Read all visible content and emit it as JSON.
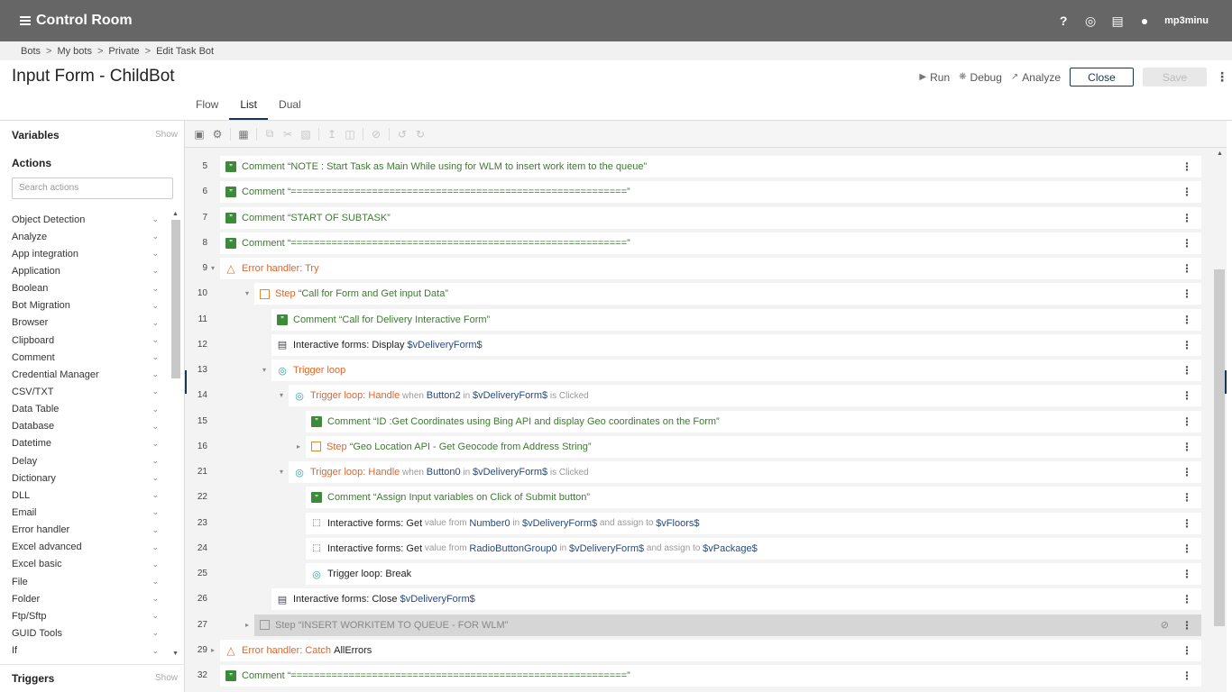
{
  "app": {
    "title": "Control Room",
    "user": "mp3minu"
  },
  "breadcrumb": [
    "Bots",
    "My bots",
    "Private",
    "Edit Task Bot"
  ],
  "page": {
    "title": "Input Form - ChildBot"
  },
  "header_actions": {
    "run": "Run",
    "debug": "Debug",
    "analyze": "Analyze",
    "close": "Close",
    "save": "Save"
  },
  "tabs": [
    {
      "label": "Flow"
    },
    {
      "label": "List",
      "active": true
    },
    {
      "label": "Dual"
    }
  ],
  "left": {
    "variables": "Variables",
    "actions": "Actions",
    "triggers": "Triggers",
    "show": "Show",
    "search_placeholder": "Search actions",
    "action_items": [
      "Object Detection",
      "Analyze",
      "App integration",
      "Application",
      "Boolean",
      "Bot Migration",
      "Browser",
      "Clipboard",
      "Comment",
      "Credential Manager",
      "CSV/TXT",
      "Data Table",
      "Database",
      "Datetime",
      "Delay",
      "Dictionary",
      "DLL",
      "Email",
      "Error handler",
      "Excel advanced",
      "Excel basic",
      "File",
      "Folder",
      "Ftp/Sftp",
      "GUID Tools",
      "If"
    ]
  },
  "lines": [
    {
      "n": "5",
      "indent": 0,
      "icon": "comment",
      "parts": [
        [
          "green",
          "Comment"
        ],
        [
          "green",
          " “NOTE : Start Task as Main While using for WLM to insert work item to the queue”"
        ]
      ]
    },
    {
      "n": "6",
      "indent": 0,
      "icon": "comment",
      "parts": [
        [
          "green",
          "Comment"
        ],
        [
          "green",
          " “==========================================================”"
        ]
      ]
    },
    {
      "n": "7",
      "indent": 0,
      "icon": "comment",
      "parts": [
        [
          "green",
          "Comment"
        ],
        [
          "green",
          " “START OF SUBTASK”"
        ]
      ]
    },
    {
      "n": "8",
      "indent": 0,
      "icon": "comment",
      "parts": [
        [
          "green",
          "Comment"
        ],
        [
          "green",
          " “==========================================================”"
        ]
      ]
    },
    {
      "n": "9",
      "indent": 0,
      "icon": "error",
      "fold": "open",
      "parts": [
        [
          "orange",
          "Error handler: Try"
        ]
      ]
    },
    {
      "n": "10",
      "indent": 1,
      "icon": "step",
      "fold": "open",
      "parts": [
        [
          "orange",
          "Step"
        ],
        [
          "green",
          " “Call for Form and Get input Data”"
        ]
      ]
    },
    {
      "n": "11",
      "indent": 2,
      "icon": "comment",
      "parts": [
        [
          "green",
          "Comment"
        ],
        [
          "green",
          " “Call for Delivery Interactive Form”"
        ]
      ]
    },
    {
      "n": "12",
      "indent": 2,
      "icon": "form",
      "parts": [
        [
          "dark",
          "Interactive forms: Display "
        ],
        [
          "blue",
          "$vDeliveryForm$"
        ]
      ]
    },
    {
      "n": "13",
      "indent": 2,
      "icon": "trigger",
      "fold": "open",
      "parts": [
        [
          "orange",
          "Trigger loop"
        ]
      ]
    },
    {
      "n": "14",
      "indent": 3,
      "icon": "trigger",
      "fold": "open",
      "parts": [
        [
          "orange",
          "Trigger loop: Handle"
        ],
        [
          "gray",
          " when "
        ],
        [
          "blue",
          "Button2"
        ],
        [
          "gray",
          " in "
        ],
        [
          "blue",
          "$vDeliveryForm$"
        ],
        [
          "gray",
          " is Clicked"
        ]
      ]
    },
    {
      "n": "15",
      "indent": 4,
      "icon": "comment",
      "parts": [
        [
          "green",
          "Comment"
        ],
        [
          "green",
          " “ID :Get Coordinates using Bing API and display Geo coordinates on the Form”"
        ]
      ]
    },
    {
      "n": "16",
      "indent": 4,
      "icon": "step",
      "fold": "closed",
      "parts": [
        [
          "orange",
          "Step"
        ],
        [
          "green",
          " “Geo Location API - Get Geocode from Address String”"
        ]
      ]
    },
    {
      "n": "21",
      "indent": 3,
      "icon": "trigger",
      "fold": "open",
      "parts": [
        [
          "orange",
          "Trigger loop: Handle"
        ],
        [
          "gray",
          " when "
        ],
        [
          "blue",
          "Button0"
        ],
        [
          "gray",
          " in "
        ],
        [
          "blue",
          "$vDeliveryForm$"
        ],
        [
          "gray",
          " is Clicked"
        ]
      ]
    },
    {
      "n": "22",
      "indent": 4,
      "icon": "comment",
      "parts": [
        [
          "green",
          "Comment"
        ],
        [
          "green",
          " “Assign Input variables on Click of Submit button”"
        ]
      ]
    },
    {
      "n": "23",
      "indent": 4,
      "icon": "get",
      "parts": [
        [
          "dark",
          "Interactive forms: Get"
        ],
        [
          "gray",
          " value from "
        ],
        [
          "blue",
          "Number0"
        ],
        [
          "gray",
          " in "
        ],
        [
          "blue",
          "$vDeliveryForm$"
        ],
        [
          "gray",
          " and assign to "
        ],
        [
          "blue",
          "$vFloors$"
        ]
      ]
    },
    {
      "n": "24",
      "indent": 4,
      "icon": "get",
      "parts": [
        [
          "dark",
          "Interactive forms: Get"
        ],
        [
          "gray",
          " value from "
        ],
        [
          "blue",
          "RadioButtonGroup0"
        ],
        [
          "gray",
          " in "
        ],
        [
          "blue",
          "$vDeliveryForm$"
        ],
        [
          "gray",
          " and assign to "
        ],
        [
          "blue",
          "$vPackage$"
        ]
      ]
    },
    {
      "n": "25",
      "indent": 4,
      "icon": "trigger",
      "parts": [
        [
          "dark",
          "Trigger loop: Break"
        ]
      ]
    },
    {
      "n": "26",
      "indent": 2,
      "icon": "form",
      "parts": [
        [
          "dark",
          "Interactive forms: Close "
        ],
        [
          "blue",
          "$vDeliveryForm$"
        ]
      ]
    },
    {
      "n": "27",
      "indent": 1,
      "icon": "step",
      "fold": "closed",
      "disabled": true,
      "parts": [
        [
          "gray2",
          "Step"
        ],
        [
          "gray2",
          " “INSERT WORKITEM TO QUEUE - FOR WLM”"
        ]
      ]
    },
    {
      "n": "29",
      "indent": 0,
      "icon": "error",
      "fold": "closed",
      "parts": [
        [
          "orange",
          "Error handler: Catch "
        ],
        [
          "dark",
          "AllErrors"
        ]
      ]
    },
    {
      "n": "32",
      "indent": 0,
      "icon": "comment",
      "parts": [
        [
          "green",
          "Comment"
        ],
        [
          "green",
          " “==========================================================”"
        ]
      ]
    }
  ]
}
